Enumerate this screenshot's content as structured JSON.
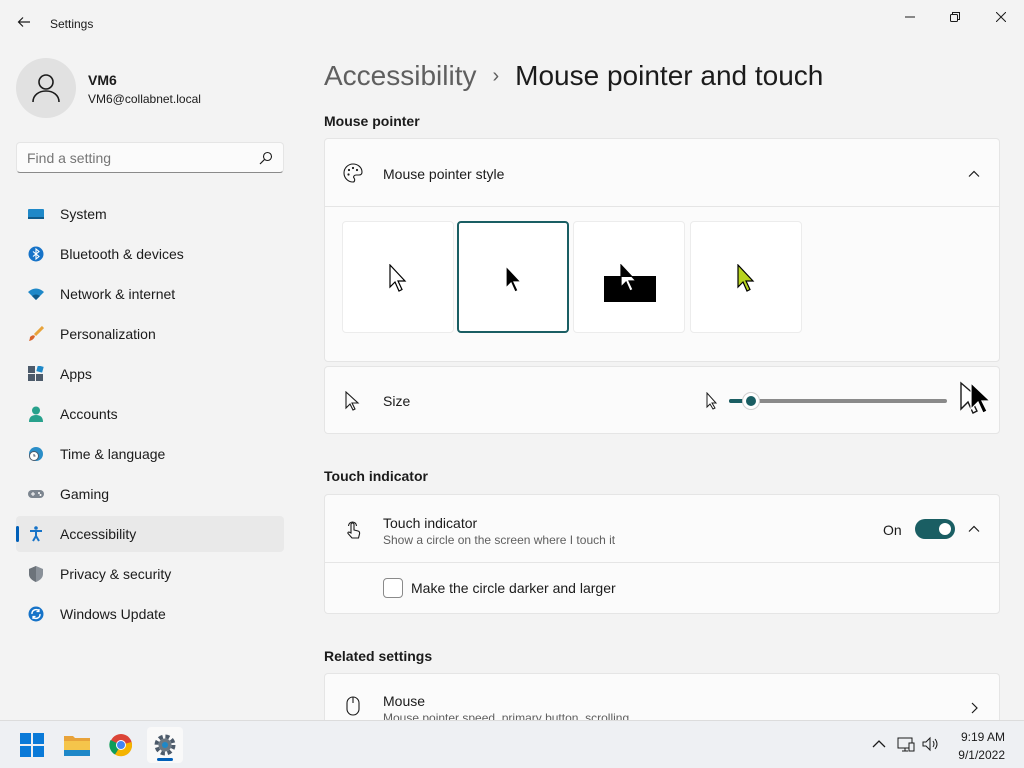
{
  "window": {
    "title": "Settings",
    "minimize_icon": "minimize-icon",
    "maximize_icon": "restore-icon",
    "close_icon": "close-icon"
  },
  "profile": {
    "name": "VM6",
    "email": "VM6@collabnet.local"
  },
  "search": {
    "placeholder": "Find a setting"
  },
  "sidebar": {
    "items": [
      {
        "label": "System",
        "icon": "system-icon",
        "active": false
      },
      {
        "label": "Bluetooth & devices",
        "icon": "bluetooth-icon",
        "active": false
      },
      {
        "label": "Network & internet",
        "icon": "wifi-icon",
        "active": false
      },
      {
        "label": "Personalization",
        "icon": "brush-icon",
        "active": false
      },
      {
        "label": "Apps",
        "icon": "apps-icon",
        "active": false
      },
      {
        "label": "Accounts",
        "icon": "accounts-icon",
        "active": false
      },
      {
        "label": "Time & language",
        "icon": "globe-clock-icon",
        "active": false
      },
      {
        "label": "Gaming",
        "icon": "gamepad-icon",
        "active": false
      },
      {
        "label": "Accessibility",
        "icon": "accessibility-icon",
        "active": true
      },
      {
        "label": "Privacy & security",
        "icon": "shield-icon",
        "active": false
      },
      {
        "label": "Windows Update",
        "icon": "update-icon",
        "active": false
      }
    ]
  },
  "breadcrumb": {
    "parent": "Accessibility",
    "separator": "›",
    "current": "Mouse pointer and touch"
  },
  "mouse_pointer": {
    "section_title": "Mouse pointer",
    "style_label": "Mouse pointer style",
    "styles": [
      {
        "name": "White",
        "selected": false
      },
      {
        "name": "Black",
        "selected": true
      },
      {
        "name": "Inverted",
        "selected": false
      },
      {
        "name": "Custom",
        "selected": false
      }
    ],
    "size_label": "Size",
    "size_value_fraction": 0.1
  },
  "touch": {
    "section_title": "Touch indicator",
    "label": "Touch indicator",
    "description": "Show a circle on the screen where I touch it",
    "state_label": "On",
    "enabled": true,
    "option_label": "Make the circle darker and larger",
    "option_checked": false
  },
  "related": {
    "section_title": "Related settings",
    "mouse_label": "Mouse",
    "mouse_desc": "Mouse pointer speed, primary button, scrolling"
  },
  "taskbar": {
    "time": "9:19 AM",
    "date": "9/1/2022",
    "apps": [
      "start-icon",
      "file-explorer-icon",
      "chrome-icon",
      "settings-icon"
    ]
  },
  "colors": {
    "accent": "#1a5e63",
    "windows_blue": "#005fb8"
  }
}
